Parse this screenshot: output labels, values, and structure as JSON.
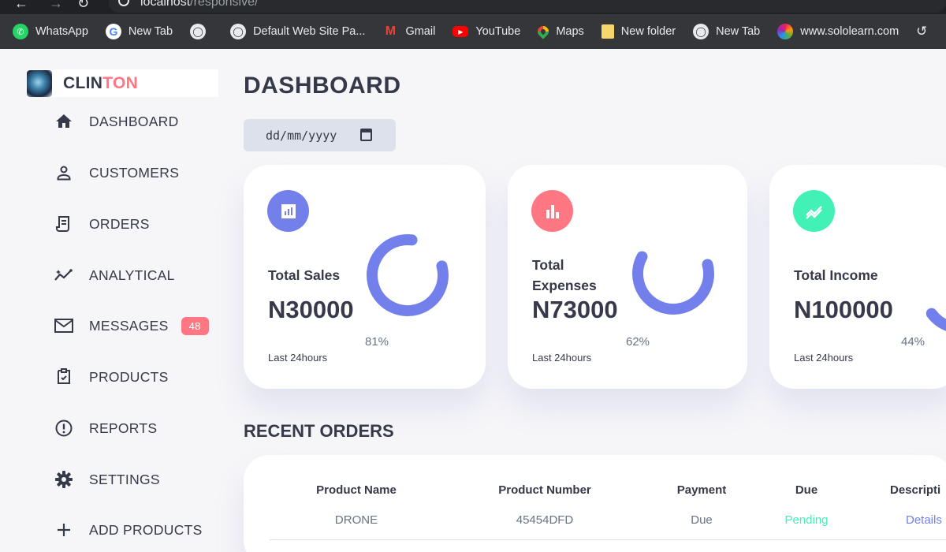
{
  "browser": {
    "url_host": "localhost",
    "url_path": "/responsive/",
    "bookmarks": [
      {
        "label": "WhatsApp",
        "icon": "whatsapp-icon"
      },
      {
        "label": "New Tab",
        "icon": "google-icon"
      },
      {
        "label": "",
        "icon": "globe-icon"
      },
      {
        "label": "Default Web Site Pa...",
        "icon": "globe-icon"
      },
      {
        "label": "Gmail",
        "icon": "gmail-icon"
      },
      {
        "label": "YouTube",
        "icon": "youtube-icon"
      },
      {
        "label": "Maps",
        "icon": "maps-icon"
      },
      {
        "label": "New folder",
        "icon": "folder-icon"
      },
      {
        "label": "New Tab",
        "icon": "globe-icon"
      },
      {
        "label": "www.sololearn.com",
        "icon": "sololearn-icon"
      }
    ]
  },
  "sidebar": {
    "logo_part1": "CLIN",
    "logo_part2": "TON",
    "items": [
      {
        "label": "DASHBOARD",
        "icon": "home-icon"
      },
      {
        "label": "CUSTOMERS",
        "icon": "person-icon"
      },
      {
        "label": "ORDERS",
        "icon": "receipt-icon"
      },
      {
        "label": "ANALYTICAL",
        "icon": "insights-icon"
      },
      {
        "label": "MESSAGES",
        "icon": "mail-icon",
        "badge": "48"
      },
      {
        "label": "PRODUCTS",
        "icon": "inventory-icon"
      },
      {
        "label": "REPORTS",
        "icon": "report-icon"
      },
      {
        "label": "SETTINGS",
        "icon": "gear-icon"
      },
      {
        "label": "ADD PRODUCTS",
        "icon": "plus-icon"
      }
    ]
  },
  "main": {
    "title": "DASHBOARD",
    "date_placeholder": "dd/mm/yyyy",
    "cards": [
      {
        "label_line1": "Total Sales",
        "label_line2": "",
        "amount": "N30000",
        "percent": "81%",
        "percent_value": 0.81,
        "note": "Last 24hours",
        "icon": "analytics-icon",
        "icon_color": "#7380ec"
      },
      {
        "label_line1": "Total",
        "label_line2": "Expenses",
        "amount": "N73000",
        "percent": "62%",
        "percent_value": 0.62,
        "note": "Last 24hours",
        "icon": "bar-chart-icon",
        "icon_color": "#ff7782"
      },
      {
        "label_line1": "Total Income",
        "label_line2": "",
        "amount": "N100000",
        "percent": "44%",
        "percent_value": 0.44,
        "note": "Last 24hours",
        "icon": "trending-icon",
        "icon_color": "#41f1b6"
      }
    ],
    "ring_color": "#7380ec",
    "recent_title": "RECENT ORDERS",
    "table": {
      "headers": [
        "Product Name",
        "Product Number",
        "Payment",
        "Due",
        "Descripti"
      ],
      "rows": [
        [
          "DRONE",
          "45454DFD",
          "Due",
          "Pending",
          "Details"
        ]
      ]
    }
  }
}
